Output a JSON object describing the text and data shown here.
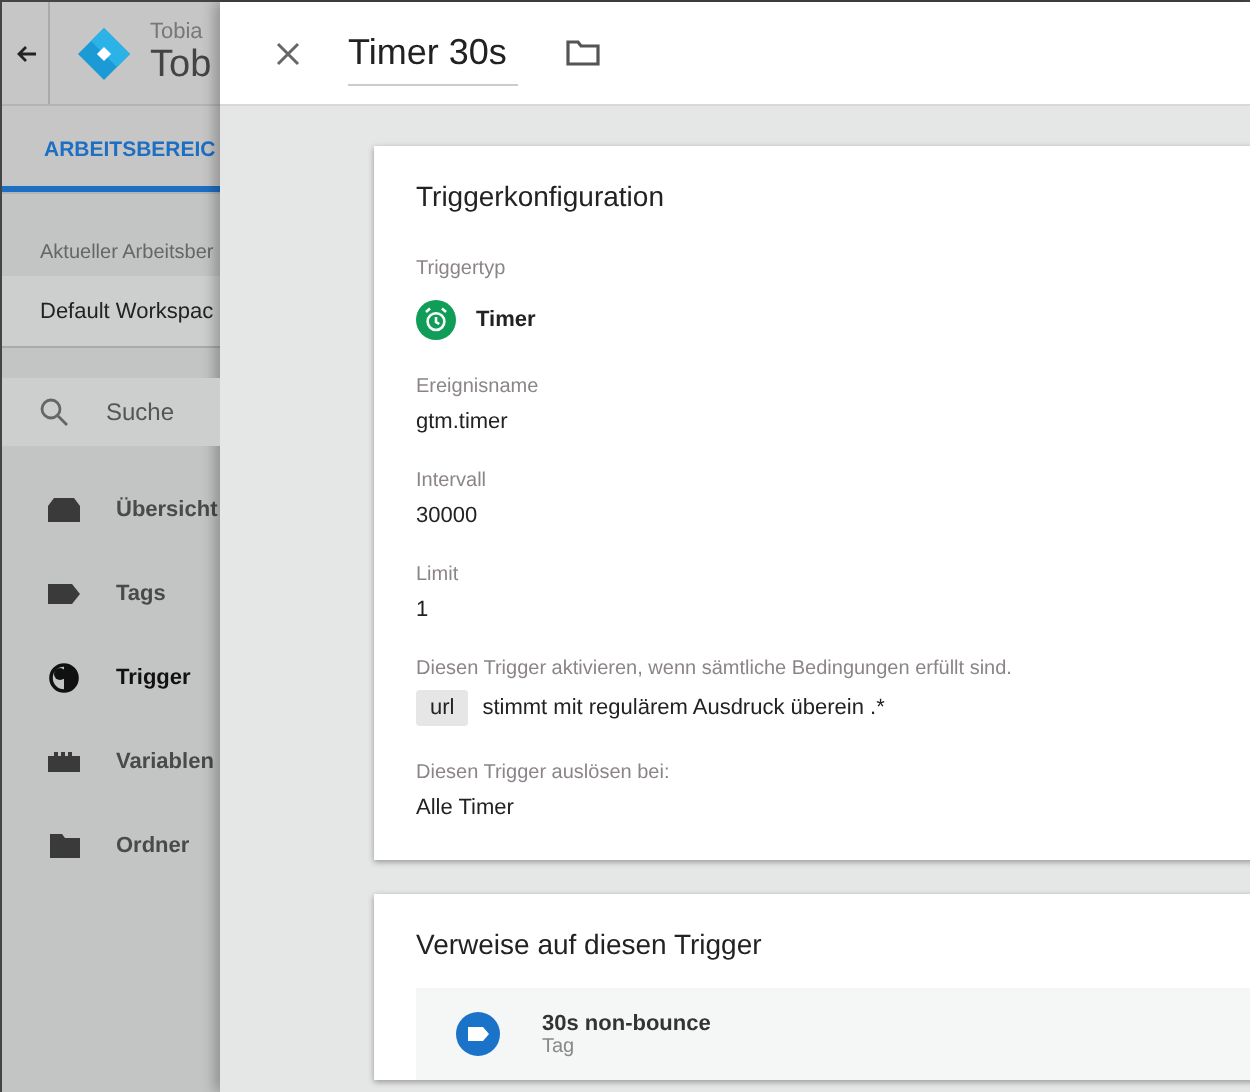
{
  "sidebar": {
    "account": "Tobia",
    "container": "Tob",
    "tab": {
      "label": "ARBEITSBEREIC",
      "selected": true
    },
    "workspace_label": "Aktueller Arbeitsber",
    "workspace": "Default Workspac",
    "search": {
      "placeholder": "Suche"
    },
    "items": [
      {
        "label": "Übersicht",
        "kind": "overview",
        "selected": false
      },
      {
        "label": "Tags",
        "kind": "tag",
        "selected": false
      },
      {
        "label": "Trigger",
        "kind": "trigger",
        "selected": true
      },
      {
        "label": "Variablen",
        "kind": "variable",
        "selected": false
      },
      {
        "label": "Ordner",
        "kind": "folder",
        "selected": false
      }
    ]
  },
  "panel": {
    "title": "Timer 30s",
    "config": {
      "heading": "Triggerkonfiguration",
      "type_label": "Triggertyp",
      "type": "Timer",
      "fields": [
        {
          "label": "Ereignisname",
          "value": "gtm.timer"
        },
        {
          "label": "Intervall",
          "value": "30000"
        },
        {
          "label": "Limit",
          "value": "1"
        }
      ],
      "condition_label": "Diesen Trigger aktivieren, wenn sämtliche Bedingungen erfüllt sind.",
      "conditions": [
        {
          "variable": "url",
          "rule": "stimmt mit regulärem Ausdruck überein .*"
        }
      ],
      "fire_label": "Diesen Trigger auslösen bei:",
      "fire_on": "Alle Timer"
    },
    "references": {
      "heading": "Verweise auf diesen Trigger",
      "items": [
        {
          "name": "30s non-bounce",
          "type": "Tag"
        }
      ]
    }
  }
}
